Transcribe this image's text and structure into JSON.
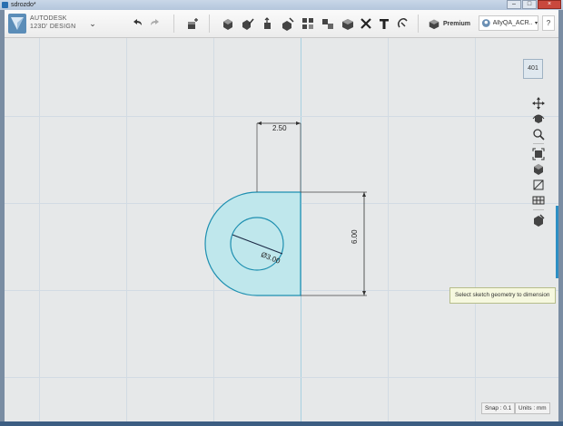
{
  "window": {
    "title": "sdrozdo*",
    "controls": [
      "–",
      "□",
      "×"
    ]
  },
  "app": {
    "brand_line1": "AUTODESK",
    "brand_line2": "123D' DESIGN",
    "menu_chevron": "⌄"
  },
  "toolbar": {
    "buttons": [
      {
        "name": "undo-icon"
      },
      {
        "name": "redo-icon"
      },
      {
        "name": "add-primitive-icon"
      },
      {
        "name": "transform-icon"
      },
      {
        "name": "sketch-icon"
      },
      {
        "name": "construct-icon"
      },
      {
        "name": "modify-icon"
      },
      {
        "name": "pattern-icon"
      },
      {
        "name": "group-icon"
      },
      {
        "name": "combine-icon"
      },
      {
        "name": "measure-icon"
      },
      {
        "name": "text-icon"
      },
      {
        "name": "snap-icon"
      }
    ],
    "premium_label": "Premium",
    "account_name": "AllyQA_ACR...",
    "account_dropdown": "▾",
    "help_label": "?"
  },
  "canvas": {
    "viewcube_label": "401",
    "dimensions": {
      "top": "2.50",
      "right": "6.00",
      "diameter": "Ø3.00"
    },
    "tooltip": "Select sketch geometry to dimension"
  },
  "status": {
    "snap": "Snap : 0.1",
    "units": "Units : mm"
  },
  "colors": {
    "sketch_fill": "#bfe7ec",
    "sketch_stroke": "#1e8fb0",
    "accent": "#2d8fc4"
  }
}
